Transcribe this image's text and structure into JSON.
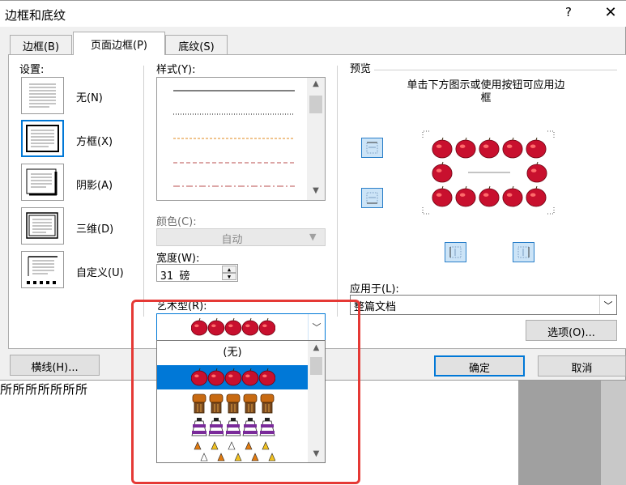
{
  "background_doc": {
    "text": "所所所所所所所"
  },
  "dialog": {
    "title": "边框和底纹",
    "help_glyph": "?",
    "close_glyph": "✕"
  },
  "tabs": [
    {
      "label": "边框(B)",
      "active": false
    },
    {
      "label": "页面边框(P)",
      "active": true
    },
    {
      "label": "底纹(S)",
      "active": false
    }
  ],
  "settings": {
    "label": "设置:",
    "items": [
      {
        "label": "无(N)",
        "icon": "setting-none-icon",
        "selected": false
      },
      {
        "label": "方框(X)",
        "icon": "setting-box-icon",
        "selected": true
      },
      {
        "label": "阴影(A)",
        "icon": "setting-shadow-icon",
        "selected": false
      },
      {
        "label": "三维(D)",
        "icon": "setting-3d-icon",
        "selected": false
      },
      {
        "label": "自定义(U)",
        "icon": "setting-custom-icon",
        "selected": false
      }
    ]
  },
  "style": {
    "label": "样式(Y):",
    "lines": [
      {
        "kind": "solid",
        "color": "#000000"
      },
      {
        "kind": "dotted",
        "color": "#000000"
      },
      {
        "kind": "dashed",
        "color": "#e08a1e"
      },
      {
        "kind": "dashed",
        "color": "#b84c4c"
      },
      {
        "kind": "dash-dot",
        "color": "#b84c4c"
      }
    ]
  },
  "color": {
    "label": "颜色(C):",
    "value": "自动"
  },
  "width": {
    "label": "宽度(W):",
    "value": "31 磅"
  },
  "art": {
    "label": "艺术型(R):",
    "selected_icon": "apple-art-icon",
    "options": [
      {
        "label": "(无)",
        "icon": ""
      },
      {
        "label": "",
        "icon": "apple-art-icon",
        "highlighted": true
      },
      {
        "label": "",
        "icon": "pumpkin-art-icon"
      },
      {
        "label": "",
        "icon": "cake-art-icon"
      },
      {
        "label": "",
        "icon": "candy-art-icon"
      }
    ]
  },
  "preview": {
    "label": "预览",
    "hint_line1": "单击下方图示或使用按钮可应用边",
    "hint_line2": "框"
  },
  "apply": {
    "label": "应用于(L):",
    "value": "整篇文档"
  },
  "buttons": {
    "options": "选项(O)...",
    "horizontal_line": "横线(H)...",
    "ok": "确定",
    "cancel": "取消"
  },
  "colors": {
    "accent": "#0078d7",
    "annotation": "#e53935",
    "apple": "#c8102e"
  }
}
